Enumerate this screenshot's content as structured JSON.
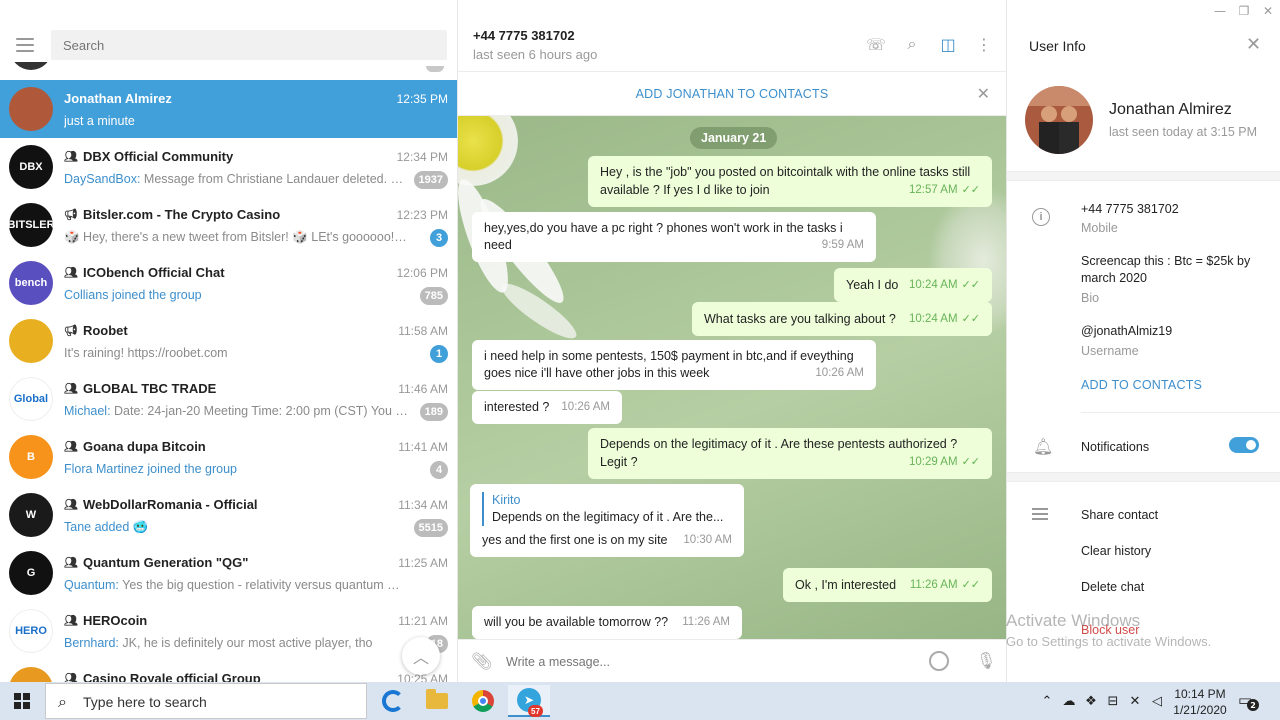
{
  "window": {
    "minimize": "—",
    "restore": "❐",
    "close": "✕"
  },
  "sidebar": {
    "search_placeholder": "Search",
    "chats": [
      {
        "name": "Jonathan Almirez",
        "time": "12:35 PM",
        "preview": "just a minute",
        "type": "user",
        "active": true,
        "avatar_color": "#b0583a"
      },
      {
        "name": "DBX Official Community",
        "time": "12:34 PM",
        "sender": "DaySandBox:",
        "preview": " Message from Christiane Landauer deleted. Re...",
        "badge": "1937",
        "type": "group",
        "avatar_text": "DBX",
        "avatar_color": "#111111"
      },
      {
        "name": "Bitsler.com - The Crypto Casino",
        "time": "12:23 PM",
        "preview": "🎲 Hey, there's a new tweet from Bitsler! 🎲 LEt's goooooo!!!! ...",
        "badge": "3",
        "badge_blue": true,
        "type": "channel",
        "avatar_text": "BITSLER",
        "avatar_color": "#111111"
      },
      {
        "name": "ICObench Official Chat",
        "time": "12:06 PM",
        "preview": "Collians joined the group",
        "preview_blue": true,
        "badge": "785",
        "type": "group",
        "avatar_text": "bench",
        "avatar_color": "#5a4fbf"
      },
      {
        "name": "Roobet",
        "time": "11:58 AM",
        "preview": "It's raining!  https://roobet.com",
        "badge": "1",
        "badge_blue": true,
        "type": "channel",
        "avatar_text": "",
        "avatar_color": "#e8b020"
      },
      {
        "name": "GLOBAL TBC TRADE",
        "time": "11:46 AM",
        "sender": "Michael:",
        "preview": " Date: 24-jan-20 Meeting Time: 2:00 pm (CST)  You can...",
        "badge": "189",
        "type": "group",
        "avatar_text": "Global",
        "avatar_color": "#ffffff"
      },
      {
        "name": "Goana dupa Bitcoin",
        "time": "11:41 AM",
        "preview": "Flora Martinez joined the group",
        "preview_blue": true,
        "badge": "4",
        "type": "group",
        "avatar_text": "B",
        "avatar_color": "#f7931a"
      },
      {
        "name": "WebDollarRomania - Official",
        "time": "11:34 AM",
        "preview": "Tane added 🥶",
        "preview_blue": true,
        "badge": "5515",
        "type": "group",
        "avatar_text": "W",
        "avatar_color": "#1a1a1a"
      },
      {
        "name": "Quantum Generation \"QG\"",
        "time": "11:25 AM",
        "sender": "Quantum:",
        "preview": " Yes the big question - relativity versus quantum mechani...",
        "type": "group",
        "avatar_text": "G",
        "avatar_color": "#111111"
      },
      {
        "name": "HEROcoin",
        "time": "11:21 AM",
        "sender": "Bernhard:",
        "preview": " JK, he is definitely our most active player, tho",
        "badge": "18",
        "type": "group",
        "avatar_text": "HERO",
        "avatar_color": "#ffffff"
      },
      {
        "name": "Casino Royale official Group",
        "time": "10:25 AM",
        "preview": "",
        "type": "group",
        "avatar_text": "",
        "avatar_color": "#e89a20"
      }
    ],
    "scroll_up_icon": "chevron-up-icon"
  },
  "chat": {
    "title": "+44 7775 381702",
    "subtitle": "last seen 6 hours ago",
    "add_contacts_label": "ADD JONATHAN TO CONTACTS",
    "date_pill": "January 21",
    "messages": [
      {
        "dir": "out",
        "lines": [
          "Hey , is the \"job\" you posted on bitcointalk with the online tasks still",
          "available ? If yes I d like to join"
        ],
        "time": "12:57 AM"
      },
      {
        "dir": "in",
        "lines": [
          "hey,yes,do you have a pc right ? phones won't work in the tasks i",
          "need"
        ],
        "time": "9:59 AM"
      },
      {
        "dir": "out",
        "lines": [
          "Yeah I do"
        ],
        "time": "10:24 AM"
      },
      {
        "dir": "out",
        "lines": [
          "What tasks are you talking about ?"
        ],
        "time": "10:24 AM"
      },
      {
        "dir": "in",
        "lines": [
          "i need help in some pentests, 150$ payment in btc,and if eveything",
          "goes nice i'll have other jobs in this week"
        ],
        "time": "10:26 AM"
      },
      {
        "dir": "in",
        "lines": [
          "interested ?"
        ],
        "time": "10:26 AM"
      },
      {
        "dir": "out",
        "lines": [
          "Depends on the legitimacy of it .  Are these pentests authorized ?",
          "Legit ?"
        ],
        "time": "10:29 AM"
      },
      {
        "dir": "in",
        "reply_name": "Kirito",
        "reply_text": "Depends on the legitimacy of it .  Are the...",
        "lines": [
          "yes and the first one is on my site"
        ],
        "time": "10:30 AM"
      },
      {
        "dir": "out",
        "lines": [
          "Ok , I'm interested"
        ],
        "time": "11:26 AM"
      },
      {
        "dir": "in",
        "lines": [
          "will you be available tomorrow ??"
        ],
        "time": "11:26 AM"
      }
    ],
    "compose_placeholder": "Write a message..."
  },
  "info": {
    "title": "User Info",
    "name": "Jonathan Almirez",
    "seen": "last seen today at 3:15 PM",
    "phone": "+44 7775 381702",
    "phone_label": "Mobile",
    "bio": "Screencap this : Btc = $25k by march 2020",
    "bio_label": "Bio",
    "username": "@jonathAlmiz19",
    "username_label": "Username",
    "add_contacts": "ADD TO CONTACTS",
    "notifications": "Notifications",
    "notifications_on": true,
    "share": "Share contact",
    "clear": "Clear history",
    "delete": "Delete chat",
    "block": "Block user"
  },
  "watermark": {
    "line1": "Activate Windows",
    "line2": "Go to Settings to activate Windows."
  },
  "taskbar": {
    "search_text": "Type here to search",
    "telegram_badge": "57",
    "time": "10:14 PM",
    "date": "1/21/2020",
    "notification_count": "2"
  },
  "colors": {
    "accent": "#419fd9",
    "outgoing": "#eefed9",
    "link": "#3d8fcc"
  }
}
